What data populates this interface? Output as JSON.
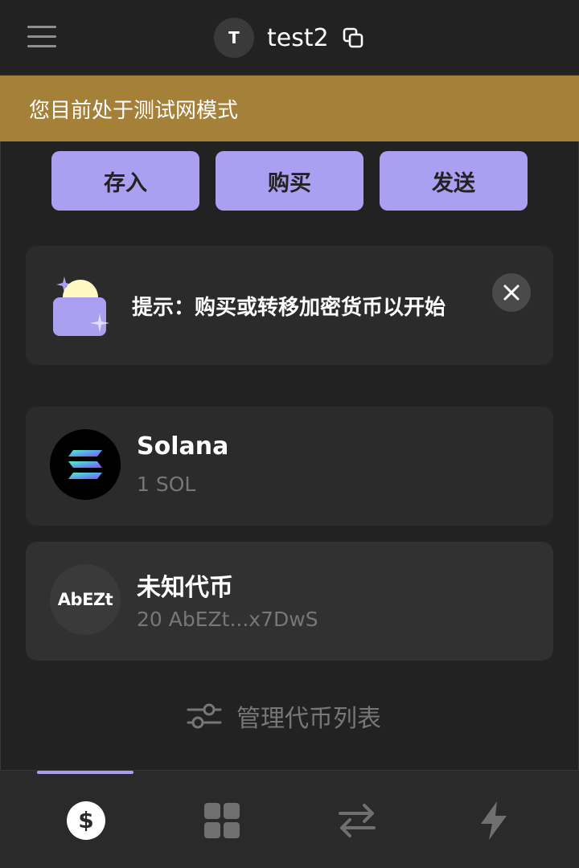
{
  "header": {
    "avatar_initial": "T",
    "account_name": "test2"
  },
  "banner": {
    "text": "您目前处于测试网模式"
  },
  "actions": [
    {
      "label": "存入"
    },
    {
      "label": "购买"
    },
    {
      "label": "发送"
    }
  ],
  "tip": {
    "text": "提示：购买或转移加密货币以开始"
  },
  "tokens": [
    {
      "name": "Solana",
      "balance": "1 SOL",
      "logo": "solana-logo"
    },
    {
      "name": "未知代币",
      "balance": "20 AbEZt...x7DwS",
      "logo_text": "AbEZt"
    }
  ],
  "manage": {
    "label": "管理代币列表"
  },
  "bottom_nav": {
    "active_tab": "tokens",
    "tabs": [
      {
        "id": "tokens",
        "icon": "dollar-circle-icon"
      },
      {
        "id": "collectibles",
        "icon": "grid-icon"
      },
      {
        "id": "swap",
        "icon": "swap-arrows-icon"
      },
      {
        "id": "activity",
        "icon": "lightning-icon"
      }
    ]
  },
  "colors": {
    "accent": "#ab9ff2",
    "banner": "#a58039",
    "background": "#222222",
    "card": "#2b2b2b",
    "muted_text": "#777777"
  }
}
